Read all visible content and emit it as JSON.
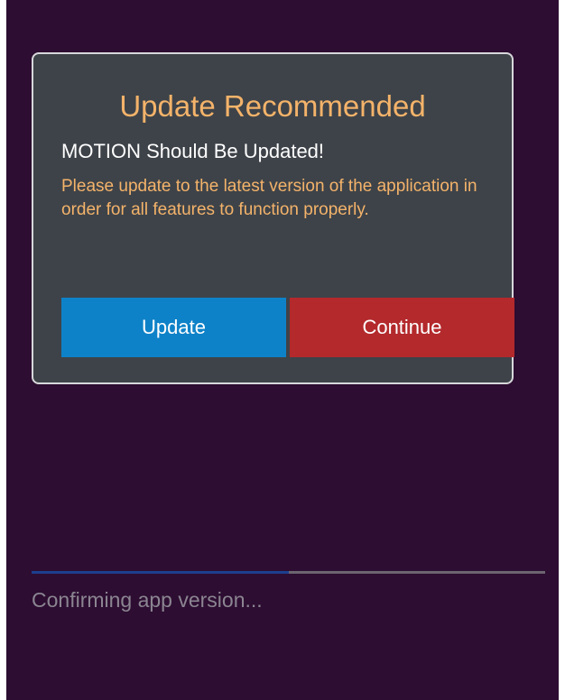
{
  "dialog": {
    "title": "Update Recommended",
    "subtitle": "MOTION Should Be Updated!",
    "message": "Please update to the latest version of the application in order for all features to function properly.",
    "update_label": "Update",
    "continue_label": "Continue"
  },
  "status": {
    "progress_fraction": 0.5,
    "text": "Confirming app version..."
  },
  "colors": {
    "background": "#2d0d32",
    "dialog_background": "#3e4349",
    "accent_text": "#f4b36a",
    "update_button": "#0e82c8",
    "continue_button": "#b3292c",
    "progress_fill": "#1d3f8f"
  }
}
